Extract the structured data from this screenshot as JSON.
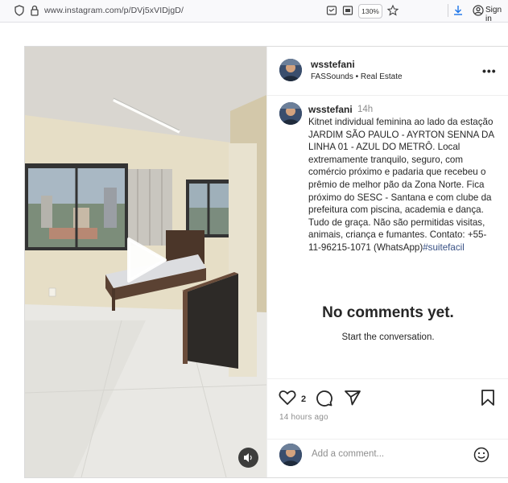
{
  "browser": {
    "url": "www.instagram.com/p/DVj5xVIDjgD/",
    "zoom": "130%",
    "signin_label": "Sign in",
    "icons": [
      "shield-icon",
      "lock-icon",
      "reader-icon",
      "screenshot-icon",
      "star-icon",
      "download-icon",
      "account-icon"
    ]
  },
  "post": {
    "username": "wsstefani",
    "subtitle": "FASSounds • Real Estate",
    "caption_username": "wsstefani",
    "time_ago": "14h",
    "caption_text": "Kitnet individual feminina ao lado da estação JARDIM SÃO PAULO - AYRTON SENNA DA LINHA 01 - AZUL DO METRÔ. Local extremamente tranquilo, seguro, com comércio próximo e padaria que recebeu o prêmio de melhor pão da Zona Norte. Fica próximo do SESC - Santana e com clube da prefeitura com piscina, academia e dança. Tudo de graça. Não são permitidas visitas, animais, criança e fumantes. Contato: +55-11-96215-1071 (WhatsApp)",
    "hashtag": "#suitefacil",
    "likes": "2",
    "posted": "14 hours ago"
  },
  "comments": {
    "empty_title": "No comments yet.",
    "empty_subtitle": "Start the conversation.",
    "placeholder": "Add a comment..."
  },
  "colors": {
    "link": "#385185",
    "muted": "#8e8e8e",
    "border": "#dbdbdb"
  }
}
